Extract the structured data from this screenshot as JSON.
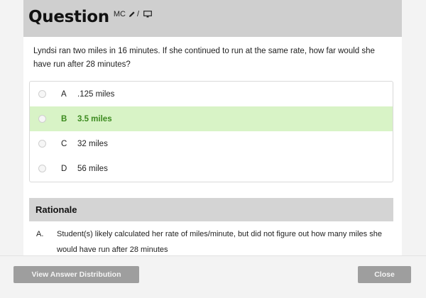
{
  "question": {
    "title": "Question",
    "type_badge": "MC",
    "edit_icon": "pencil-icon",
    "separator": "/",
    "present_icon": "monitor-icon",
    "text": "Lyndsi ran two miles in 16 minutes. If she continued to run at the same rate, how far would she have run after 28 minutes?",
    "choices": [
      {
        "letter": "A",
        "text": ".125 miles",
        "correct": false
      },
      {
        "letter": "B",
        "text": "3.5 miles",
        "correct": true
      },
      {
        "letter": "C",
        "text": "32 miles",
        "correct": false
      },
      {
        "letter": "D",
        "text": "56 miles",
        "correct": false
      }
    ]
  },
  "rationale": {
    "title": "Rationale",
    "items": [
      {
        "letter": "A.",
        "text": "Student(s) likely calculated her rate of miles/minute, but did not figure out how many miles she would have run after 28 minutes"
      }
    ]
  },
  "footer": {
    "distribution_label": "View Answer Distribution",
    "close_label": "Close"
  },
  "colors": {
    "correct_bg": "#d8f3c6",
    "correct_text": "#3b8a1e",
    "header_bg": "#cfcfcf",
    "button_bg": "#9e9e9e"
  }
}
